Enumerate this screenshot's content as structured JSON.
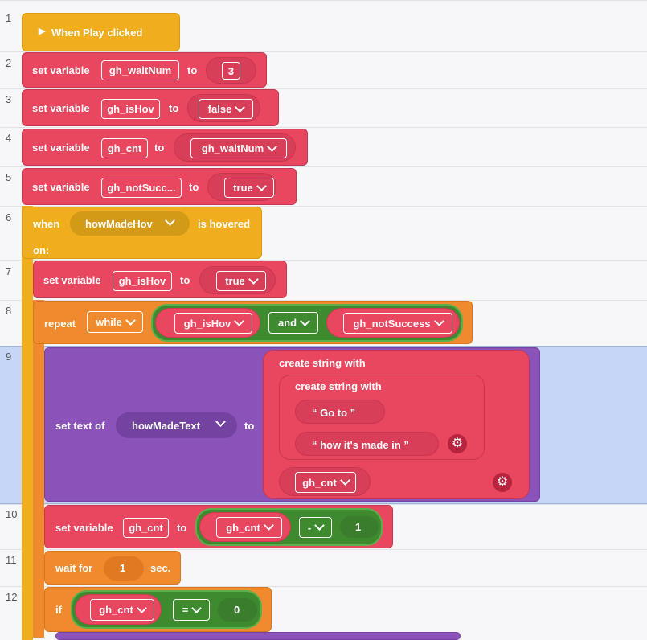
{
  "lines": [
    "1",
    "2",
    "3",
    "4",
    "5",
    "6",
    "7",
    "8",
    "9",
    "10",
    "11",
    "12"
  ],
  "start": {
    "label": "When Play clicked"
  },
  "kw": {
    "set_variable": "set variable",
    "to": "to",
    "when": "when",
    "is_hovered": "is hovered",
    "on": "on:",
    "repeat": "repeat",
    "and": "and",
    "set_text_of": "set text of",
    "create_string": "create string with",
    "wait_for": "wait for",
    "sec": "sec.",
    "if": "if",
    "minus": "-",
    "equals": "="
  },
  "vars": {
    "waitNum": "gh_waitNum",
    "isHov": "gh_isHov",
    "cnt": "gh_cnt",
    "notSucc_short": "gh_notSucc...",
    "notSuccess": "gh_notSuccess"
  },
  "values": {
    "three": "3",
    "false": "false",
    "true": "true",
    "one": "1",
    "zero": "0"
  },
  "loop_mode": "while",
  "objects": {
    "hover_target": "howMadeHov",
    "text_target": "howMadeText"
  },
  "strings": {
    "goto": "“  Go to  ”",
    "how": "“  how it's made in  ”"
  },
  "icons": {
    "gear": "gear-icon",
    "play": "play-icon",
    "dropdown": "chevron-down-icon"
  },
  "colors": {
    "event": "#f0ae1f",
    "variable": "#e8475f",
    "control": "#ef8a2f",
    "text": "#8b53b9",
    "logic": "#4c9a3e",
    "selected_row": "#c5d6f7"
  }
}
